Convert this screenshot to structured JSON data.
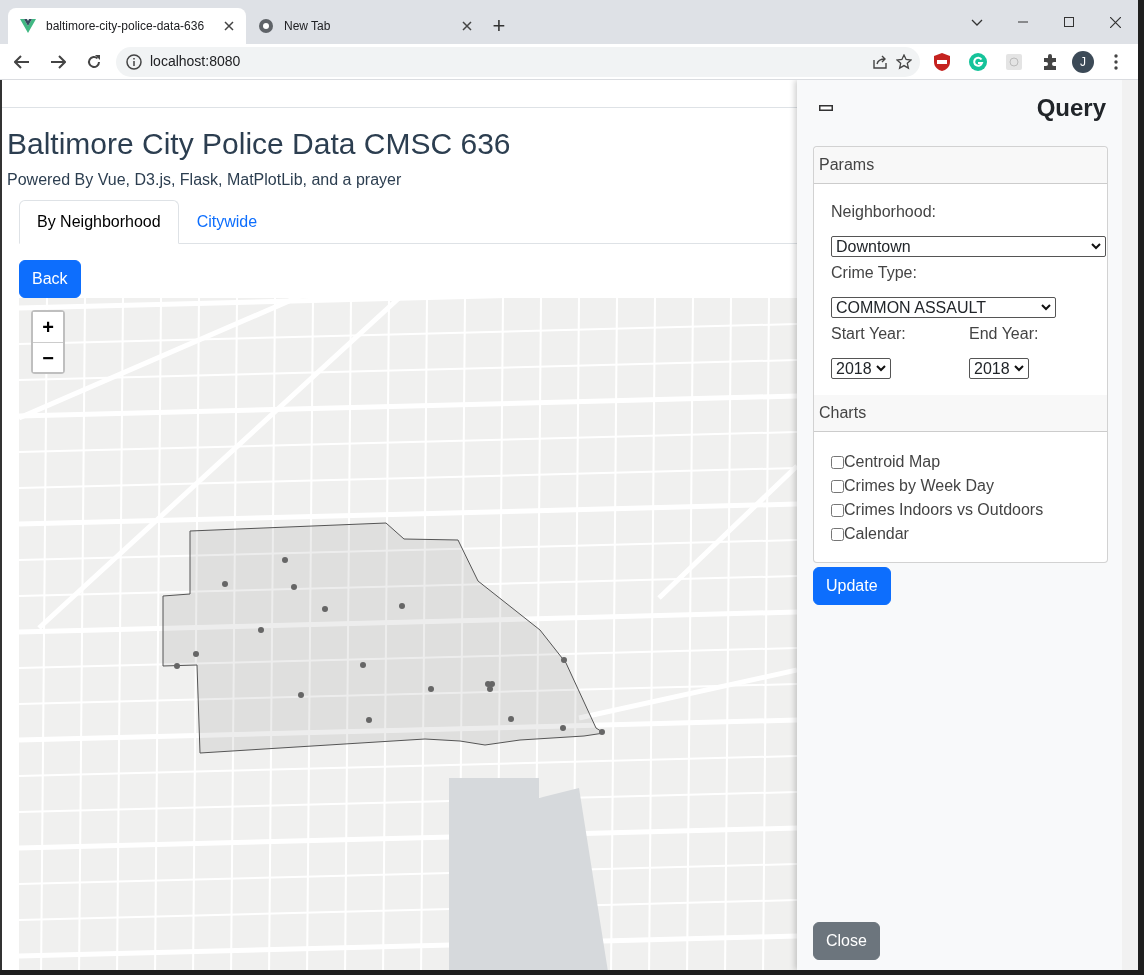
{
  "browser": {
    "tabs": [
      {
        "title": "baltimore-city-police-data-636",
        "selected": true
      },
      {
        "title": "New Tab",
        "selected": false
      }
    ],
    "new_tab": "+",
    "address": "localhost:8080",
    "profile_initial": "J"
  },
  "page": {
    "title": "Baltimore City Police Data CMSC 636",
    "subtitle": "Powered By Vue, D3.js, Flask, MatPlotLib, and a prayer",
    "tabs": [
      {
        "label": "By Neighborhood",
        "selected": true
      },
      {
        "label": "Citywide",
        "selected": false
      }
    ],
    "back_button": "Back",
    "map": {
      "zoom_in": "+",
      "zoom_out": "−"
    }
  },
  "query_panel": {
    "title": "Query",
    "params": {
      "header": "Params",
      "fields": [
        {
          "label": "Neighborhood:",
          "value": "Downtown",
          "kind": "wide"
        },
        {
          "label": "Crime Type:",
          "value": "COMMON ASSAULT",
          "kind": "medium"
        },
        {
          "label": "Start Year:",
          "value": "2018",
          "kind": "half"
        },
        {
          "label": "End Year:",
          "value": "2018",
          "kind": "half"
        }
      ]
    },
    "charts": {
      "header": "Charts",
      "options": [
        {
          "label": "Centroid Map",
          "checked": false
        },
        {
          "label": "Crimes by Week Day",
          "checked": false
        },
        {
          "label": "Crimes Indoors vs Outdoors",
          "checked": false
        },
        {
          "label": "Calendar",
          "checked": false
        }
      ]
    },
    "update_button": "Update",
    "close_button": "Close"
  }
}
